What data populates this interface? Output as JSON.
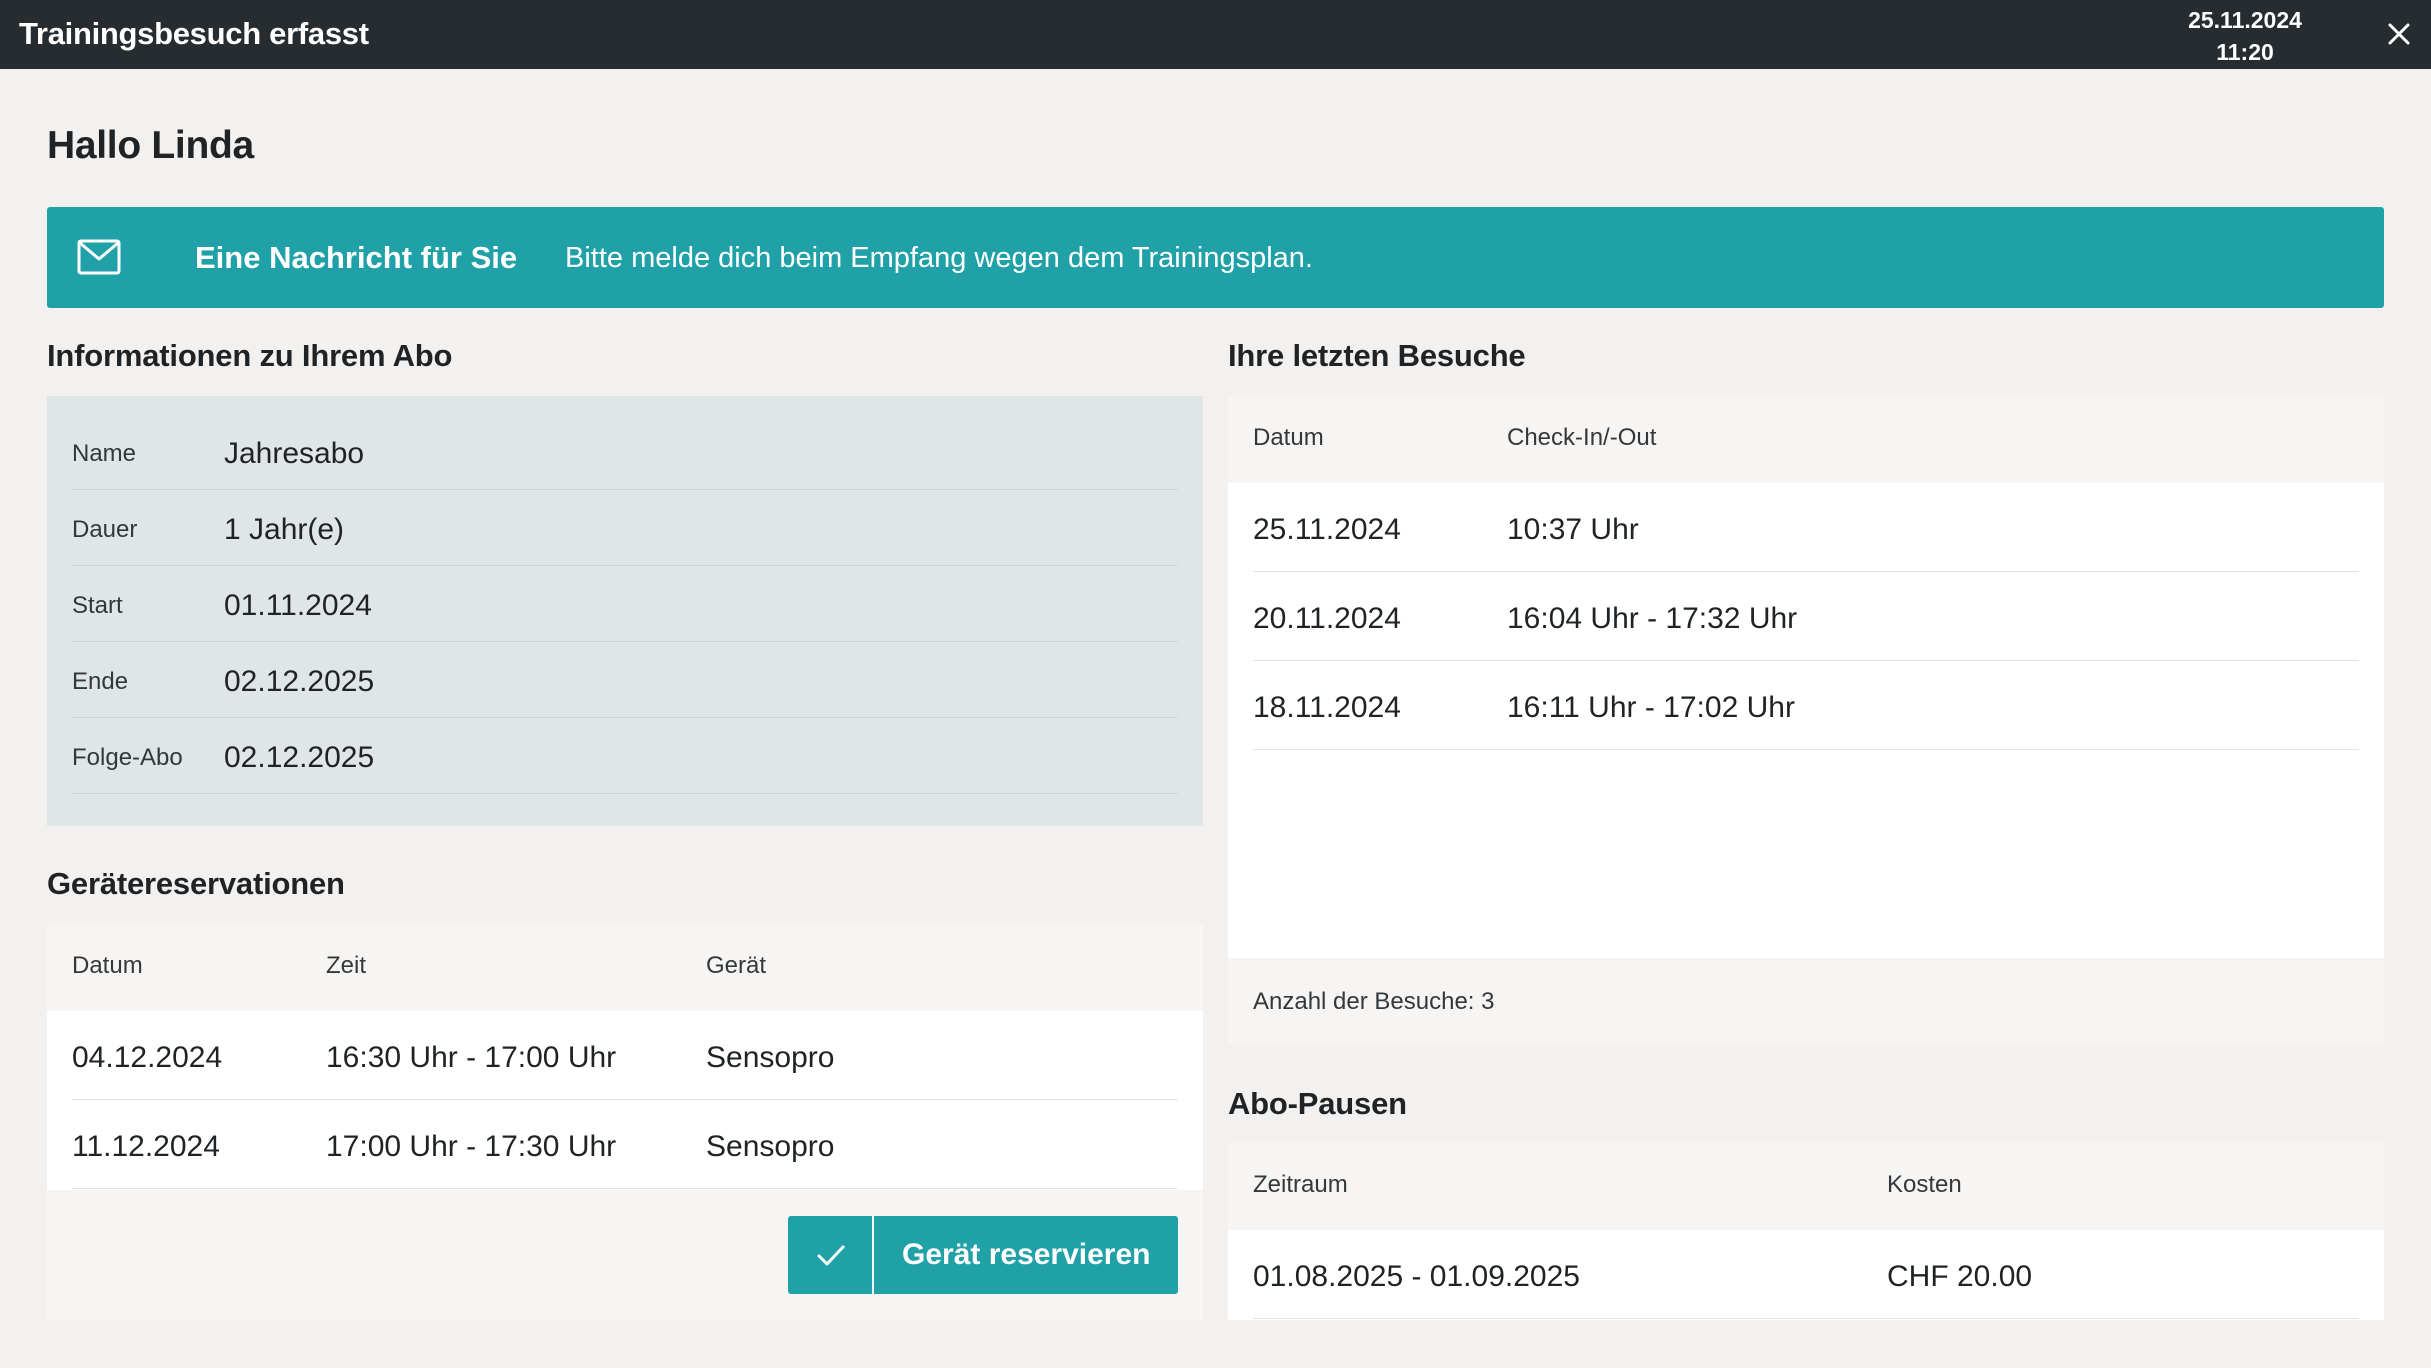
{
  "header": {
    "title": "Trainingsbesuch erfasst",
    "date": "25.11.2024",
    "time": "11:20",
    "close_icon": "close-icon"
  },
  "greeting": "Hallo Linda",
  "message": {
    "icon": "mail-icon",
    "title": "Eine Nachricht für Sie",
    "text": "Bitte melde dich beim Empfang wegen dem Trainingsplan.",
    "color": "#20a1a8"
  },
  "abo": {
    "title": "Informationen zu Ihrem Abo",
    "rows": [
      {
        "label": "Name",
        "value": "Jahresabo"
      },
      {
        "label": "Dauer",
        "value": "1 Jahr(e)"
      },
      {
        "label": "Start",
        "value": "01.11.2024"
      },
      {
        "label": "Ende",
        "value": "02.12.2025"
      },
      {
        "label": "Folge-Abo",
        "value": "02.12.2025"
      }
    ]
  },
  "reservations": {
    "title": "Gerätereservationen",
    "headers": [
      "Datum",
      "Zeit",
      "Gerät"
    ],
    "rows": [
      {
        "date": "04.12.2024",
        "time": "16:30 Uhr - 17:00 Uhr",
        "device": "Sensopro"
      },
      {
        "date": "11.12.2024",
        "time": "17:00 Uhr - 17:30 Uhr",
        "device": "Sensopro"
      }
    ],
    "button_label": "Gerät reservieren",
    "button_icon": "check-icon"
  },
  "visits": {
    "title": "Ihre letzten Besuche",
    "headers": [
      "Datum",
      "Check-In/-Out"
    ],
    "rows": [
      {
        "date": "25.11.2024",
        "checkinout": "10:37 Uhr"
      },
      {
        "date": "20.11.2024",
        "checkinout": "16:04 Uhr - 17:32 Uhr"
      },
      {
        "date": "18.11.2024",
        "checkinout": "16:11 Uhr - 17:02 Uhr"
      }
    ],
    "count_label": "Anzahl der Besuche: 3"
  },
  "pauses": {
    "title": "Abo-Pausen",
    "headers": [
      "Zeitraum",
      "Kosten"
    ],
    "rows": [
      {
        "period": "01.08.2025 - 01.09.2025",
        "cost": "CHF 20.00"
      }
    ]
  }
}
